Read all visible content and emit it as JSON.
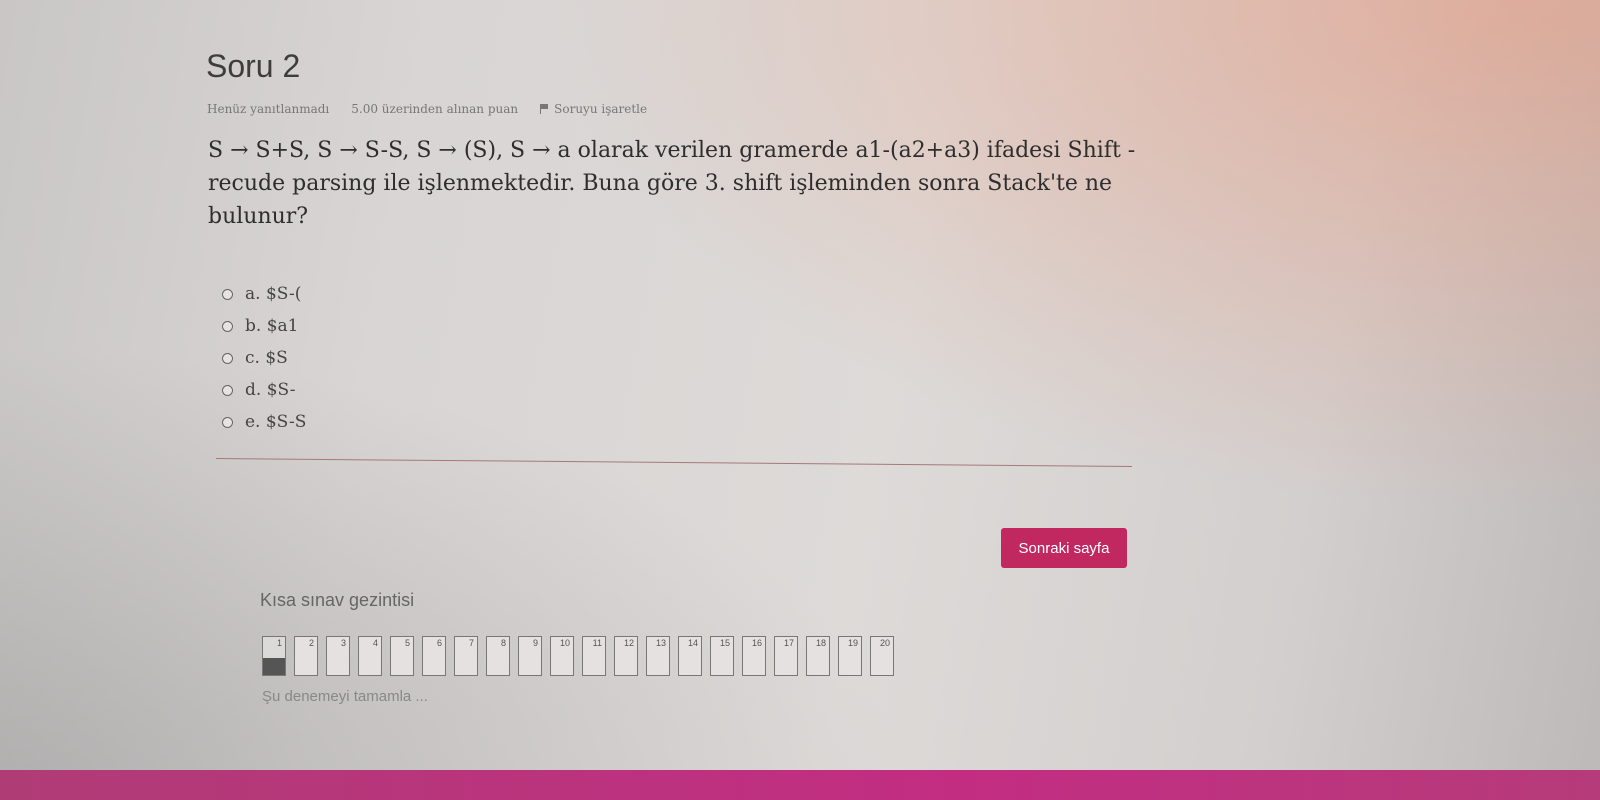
{
  "question": {
    "title": "Soru 2",
    "meta": {
      "status": "Henüz yanıtlanmadı",
      "points": "5.00 üzerinden alınan puan",
      "flag_label": "Soruyu işaretle"
    },
    "text_lines": [
      "S → S+S, S → S-S, S → (S), S → a olarak verilen gramerde a1-(a2+a3) ifadesi Shift -",
      "recude parsing ile işlenmektedir. Buna göre 3. shift işleminden sonra Stack'te ne",
      "bulunur?"
    ],
    "answers": [
      "a. $S-(",
      "b. $a1",
      "c. $S",
      "d. $S-",
      "e. $S-S"
    ]
  },
  "next_button": "Sonraki sayfa",
  "quiz_nav": {
    "title": "Kısa sınav gezintisi",
    "buttons": [
      "1",
      "2",
      "3",
      "4",
      "5",
      "6",
      "7",
      "8",
      "9",
      "10",
      "11",
      "12",
      "13",
      "14",
      "15",
      "16",
      "17",
      "18",
      "19",
      "20"
    ],
    "current": "1",
    "finish_link": "Şu denemeyi tamamla ..."
  },
  "colors": {
    "accent": "#c0285f",
    "bottom_bar": "#b83a7f"
  }
}
